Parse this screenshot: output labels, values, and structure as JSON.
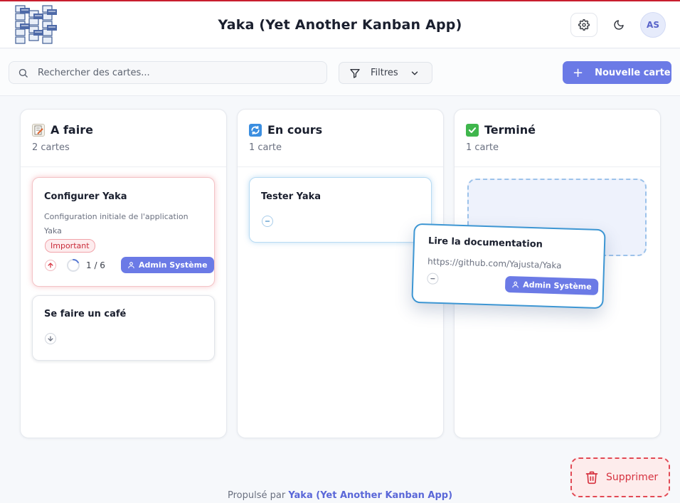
{
  "header": {
    "title": "Yaka (Yet Another Kanban App)",
    "avatar_initials": "AS",
    "settings_icon": "gear-icon",
    "theme_icon": "moon-icon"
  },
  "toolbar": {
    "search_placeholder": "Rechercher des cartes...",
    "filter_label": "Filtres",
    "new_card_label": "Nouvelle carte"
  },
  "columns": [
    {
      "emoji": "memo",
      "title": "A faire",
      "count": "2 cartes",
      "cards": [
        {
          "title": "Configurer Yaka",
          "description": "Configuration initiale de l'application Yaka",
          "tag": "Important",
          "priority": "high",
          "progress": "1 / 6",
          "progress_fraction": 0.1667,
          "assignee": "Admin Système"
        },
        {
          "title": "Se faire un café",
          "priority": "low"
        }
      ]
    },
    {
      "emoji": "arrows-counterclockwise",
      "title": "En cours",
      "count": "1 carte",
      "cards": [
        {
          "title": "Tester Yaka",
          "priority": "normal"
        }
      ]
    },
    {
      "emoji": "check-mark",
      "title": "Terminé",
      "count": "1 carte",
      "cards": []
    }
  ],
  "dragging_card": {
    "title": "Lire la documentation",
    "description": "https://github.com/Yajusta/Yaka",
    "priority": "normal",
    "assignee": "Admin Système"
  },
  "delete_zone": {
    "label": "Supprimer"
  },
  "footer": {
    "prefix": "Propulsé par",
    "link": "Yaka (Yet Another Kanban App)"
  },
  "colors": {
    "accent": "#6b7ae6",
    "danger": "#d63340",
    "drag_border": "#3d96d3"
  }
}
